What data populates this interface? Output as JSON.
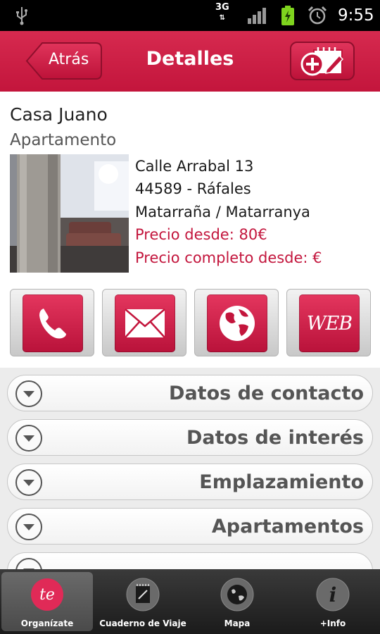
{
  "status_bar": {
    "network": "3G",
    "time": "9:55",
    "icons": [
      "usb-icon",
      "network-3g-icon",
      "signal-icon",
      "battery-icon",
      "alarm-icon"
    ]
  },
  "header": {
    "back_label": "Atrás",
    "title": "Detalles",
    "add_edit_icon": "add-edit-icon"
  },
  "listing": {
    "name": "Casa Juano",
    "type": "Apartamento",
    "address": "Calle Arrabal 13",
    "postal": "44589 - Ráfales",
    "region": "Matarraña / Matarranya",
    "price_from": "Precio desde: 80€",
    "full_price_from": "Precio completo desde:  €"
  },
  "actions": {
    "phone_icon": "phone-icon",
    "mail_icon": "mail-icon",
    "globe_icon": "globe-icon",
    "web_label": "WEB"
  },
  "sections": [
    {
      "label": "Datos de contacto"
    },
    {
      "label": "Datos de interés"
    },
    {
      "label": "Emplazamiento"
    },
    {
      "label": "Apartamentos"
    }
  ],
  "bottom_nav": {
    "items": [
      {
        "label": "Organízate",
        "icon": "te-logo-icon",
        "active": true
      },
      {
        "label": "Cuaderno de Viaje",
        "icon": "notebook-icon",
        "active": false
      },
      {
        "label": "Mapa",
        "icon": "globe-icon",
        "active": false
      },
      {
        "label": "+Info",
        "icon": "info-icon",
        "active": false
      }
    ]
  },
  "colors": {
    "brand_red": "#c3153c",
    "accent_text_red": "#c3163d"
  }
}
